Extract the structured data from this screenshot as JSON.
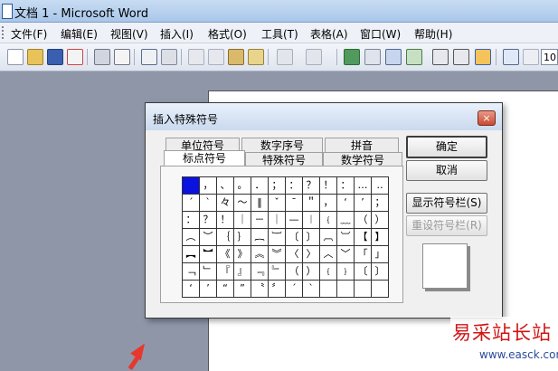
{
  "window": {
    "title": "文档 1 - Microsoft Word"
  },
  "menu": [
    "文件(F)",
    "编辑(E)",
    "视图(V)",
    "插入(I)",
    "格式(O)",
    "工具(T)",
    "表格(A)",
    "窗口(W)",
    "帮助(H)"
  ],
  "toolbar": {
    "zoom_value": "10"
  },
  "dialog": {
    "title": "插入特殊符号",
    "close_label": "×",
    "tabs_back": [
      "单位符号",
      "数字序号",
      "拼音"
    ],
    "tabs_front": [
      "标点符号",
      "特殊符号",
      "数学符号"
    ],
    "buttons": {
      "ok": "确定",
      "cancel": "取消",
      "show_bar": "显示符号栏(S)",
      "reset_bar": "重设符号栏(R)"
    },
    "symbol_grid": [
      [
        "",
        "，",
        "、",
        "。",
        "．",
        "；",
        "：",
        "？",
        "！",
        "：",
        "…",
        "‥"
      ],
      [
        "ˊ",
        "ˋ",
        "々",
        "～",
        "‖",
        "ˇ",
        "¯",
        "＂",
        "，",
        "‘",
        "’",
        "；"
      ],
      [
        "：",
        "？",
        "！",
        "｜",
        "－",
        "｜",
        "—",
        "︱",
        "﹛",
        "﹏",
        "（",
        "）"
      ],
      [
        "︵",
        "︶",
        "｛",
        "｝",
        "︷",
        "︸",
        "〔",
        "〕",
        "︹",
        "︺",
        "【",
        "】"
      ],
      [
        "︻",
        "︼",
        "《",
        "》",
        "︽",
        "︾",
        "〈",
        "〉",
        "︿",
        "﹀",
        "「",
        "」"
      ],
      [
        "﹁",
        "﹂",
        "『",
        "』",
        "﹃",
        "﹄",
        "（",
        "）",
        "﹛",
        "﹜",
        "〔",
        "〕"
      ],
      [
        "‘",
        "’",
        "“",
        "”",
        "〝",
        "〞",
        "ˊ",
        "ˋ",
        "",
        "",
        "",
        ""
      ]
    ]
  },
  "watermark": {
    "title": "易采站长站",
    "url": "www.easck.com"
  }
}
